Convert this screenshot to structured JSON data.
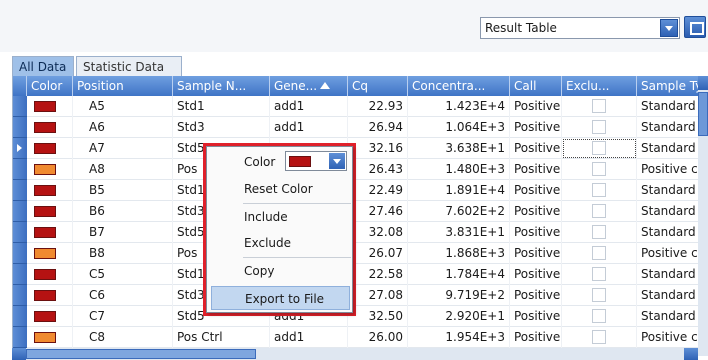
{
  "toolbar": {
    "view_select_value": "Result Table"
  },
  "tabs": [
    {
      "label": "All Data",
      "active": true
    },
    {
      "label": "Statistic Data",
      "active": false
    }
  ],
  "columns": [
    "Color",
    "Position",
    "Sample N...",
    "Gene...",
    "Cq",
    "Concentra...",
    "Call",
    "Exclu...",
    "Sample Ty"
  ],
  "sort_column": "Gene...",
  "colors": {
    "std_red": "#b51212",
    "pos_orange": "#f08a30",
    "header_blue": "#4a7fce",
    "menu_outline": "#e0212b"
  },
  "rows": [
    {
      "color": "std_red",
      "position": "A5",
      "sample": "Std1",
      "gene": "add1",
      "cq": "22.93",
      "conc": "1.423E+4",
      "call": "Positive",
      "type": "Standard"
    },
    {
      "color": "std_red",
      "position": "A6",
      "sample": "Std3",
      "gene": "add1",
      "cq": "26.94",
      "conc": "1.064E+3",
      "call": "Positive",
      "type": "Standard"
    },
    {
      "color": "std_red",
      "position": "A7",
      "sample": "Std5",
      "gene": "",
      "cq": "32.16",
      "conc": "3.638E+1",
      "call": "Positive",
      "type": "Standard"
    },
    {
      "color": "pos_orange",
      "position": "A8",
      "sample": "Pos",
      "gene": "",
      "cq": "26.43",
      "conc": "1.480E+3",
      "call": "Positive",
      "type": "Positive co"
    },
    {
      "color": "std_red",
      "position": "B5",
      "sample": "Std1",
      "gene": "",
      "cq": "22.49",
      "conc": "1.891E+4",
      "call": "Positive",
      "type": "Standard"
    },
    {
      "color": "std_red",
      "position": "B6",
      "sample": "Std3",
      "gene": "",
      "cq": "27.46",
      "conc": "7.602E+2",
      "call": "Positive",
      "type": "Standard"
    },
    {
      "color": "std_red",
      "position": "B7",
      "sample": "Std5",
      "gene": "",
      "cq": "32.08",
      "conc": "3.831E+1",
      "call": "Positive",
      "type": "Standard"
    },
    {
      "color": "pos_orange",
      "position": "B8",
      "sample": "Pos",
      "gene": "",
      "cq": "26.07",
      "conc": "1.868E+3",
      "call": "Positive",
      "type": "Positive co"
    },
    {
      "color": "std_red",
      "position": "C5",
      "sample": "Std1",
      "gene": "",
      "cq": "22.58",
      "conc": "1.784E+4",
      "call": "Positive",
      "type": "Standard"
    },
    {
      "color": "std_red",
      "position": "C6",
      "sample": "Std3",
      "gene": "",
      "cq": "27.08",
      "conc": "9.719E+2",
      "call": "Positive",
      "type": "Standard"
    },
    {
      "color": "std_red",
      "position": "C7",
      "sample": "Std5",
      "gene": "add1",
      "cq": "32.50",
      "conc": "2.920E+1",
      "call": "Positive",
      "type": "Standard"
    },
    {
      "color": "pos_orange",
      "position": "C8",
      "sample": "Pos Ctrl",
      "gene": "add1",
      "cq": "26.00",
      "conc": "1.954E+3",
      "call": "Positive",
      "type": "Positive co"
    }
  ],
  "context_menu": {
    "color_label": "Color",
    "items": [
      "Reset Color",
      "Include",
      "Exclude",
      "Copy",
      "Export to File"
    ],
    "highlighted": "Export to File"
  }
}
